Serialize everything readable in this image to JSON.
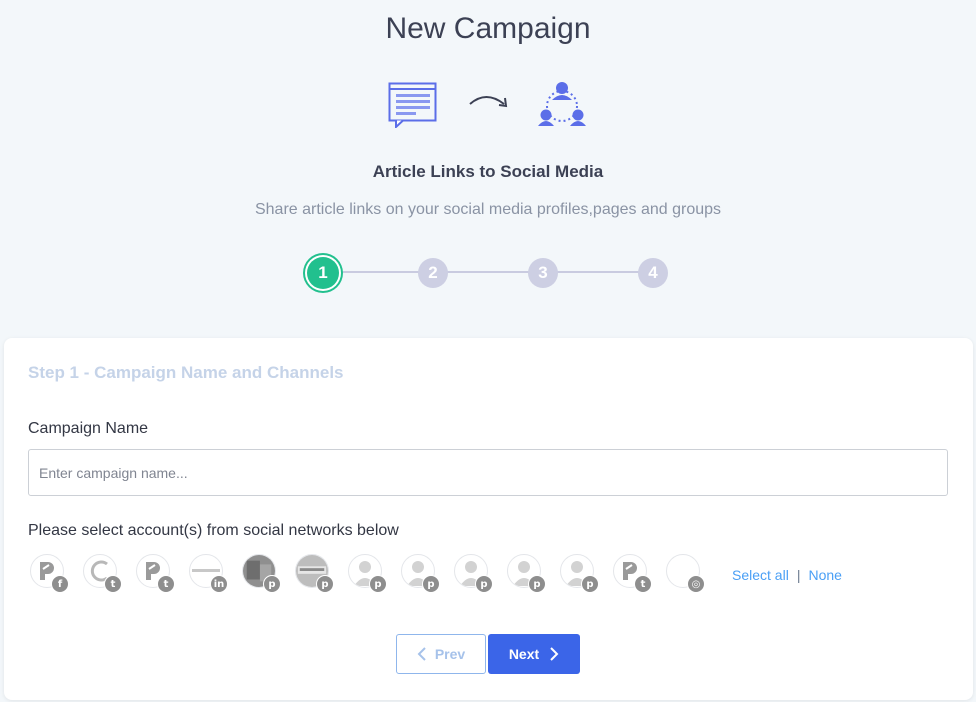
{
  "page": {
    "title": "New Campaign",
    "subtitle": "Article Links to Social Media",
    "description": "Share article links on your social media profiles,pages and groups"
  },
  "stepper": {
    "steps": [
      "1",
      "2",
      "3",
      "4"
    ],
    "active": 1
  },
  "form": {
    "heading": "Step 1 - Campaign Name and Channels",
    "campaign_label": "Campaign Name",
    "campaign_placeholder": "Enter campaign name...",
    "campaign_value": "",
    "accounts_label": "Please select account(s) from social networks below",
    "accounts": [
      {
        "network": "facebook",
        "badge": "f",
        "avatar": "p-logo"
      },
      {
        "network": "twitter",
        "badge": "t",
        "avatar": "c-logo"
      },
      {
        "network": "twitter",
        "badge": "t",
        "avatar": "p-logo"
      },
      {
        "network": "linkedin",
        "badge": "in",
        "avatar": "text-logo"
      },
      {
        "network": "pinterest",
        "badge": "p",
        "avatar": "photo"
      },
      {
        "network": "pinterest",
        "badge": "p",
        "avatar": "text-photo"
      },
      {
        "network": "pinterest",
        "badge": "p",
        "avatar": "person"
      },
      {
        "network": "pinterest",
        "badge": "p",
        "avatar": "person"
      },
      {
        "network": "pinterest",
        "badge": "p",
        "avatar": "person"
      },
      {
        "network": "pinterest",
        "badge": "p",
        "avatar": "person"
      },
      {
        "network": "pinterest",
        "badge": "p",
        "avatar": "person"
      },
      {
        "network": "tumblr",
        "badge": "t",
        "avatar": "p-logo"
      },
      {
        "network": "instagram",
        "badge": "ig",
        "avatar": "blank"
      }
    ],
    "select_all": "Select all",
    "separator": "|",
    "select_none": "None"
  },
  "buttons": {
    "prev": "Prev",
    "next": "Next"
  },
  "colors": {
    "accent": "#3b65e8",
    "active_step": "#22c08e",
    "inactive_step": "#cdcfe3",
    "link": "#4a9ff5"
  }
}
